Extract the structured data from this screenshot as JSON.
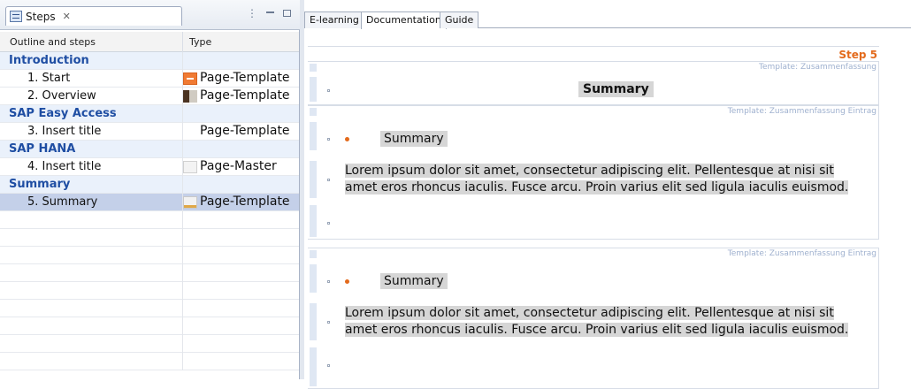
{
  "view": {
    "tab_label": "Steps",
    "close_glyph": "✕"
  },
  "table": {
    "headers": [
      "Outline and steps",
      "Type"
    ]
  },
  "tree": {
    "groups": [
      {
        "label": "Introduction",
        "steps": [
          {
            "label": "1. Start",
            "type": "Page-Template",
            "icon": "orange-template-icon"
          },
          {
            "label": "2. Overview",
            "type": "Page-Template",
            "icon": "photo-template-icon"
          }
        ]
      },
      {
        "label": "SAP Easy Access",
        "steps": [
          {
            "label": "3. Insert title",
            "type": "Page-Template",
            "icon": "none"
          }
        ]
      },
      {
        "label": "SAP HANA",
        "steps": [
          {
            "label": "4. Insert title",
            "type": "Page-Master",
            "icon": "blank-page-icon"
          }
        ]
      },
      {
        "label": "Summary",
        "steps": [
          {
            "label": "5. Summary",
            "type": "Page-Template",
            "icon": "sheet-template-icon",
            "selected": true
          }
        ]
      }
    ]
  },
  "editor": {
    "tabs": [
      {
        "label": "E-learning",
        "active": false
      },
      {
        "label": "Documentation",
        "active": true
      },
      {
        "label": "Guide",
        "active": false
      }
    ],
    "step_label": "Step 5",
    "blocks": [
      {
        "template_label": "Template: Zusammenfassung",
        "title": "Summary"
      },
      {
        "template_label": "Template: Zusammenfassung Eintrag",
        "heading": "Summary",
        "body": "Lorem ipsum dolor sit amet, consectetur adipiscing elit. Pellentesque at nisi sit amet eros rhoncus iaculis. Fusce arcu. Proin varius elit sed ligula iaculis euismod."
      },
      {
        "template_label": "Template: Zusammenfassung Eintrag",
        "heading": "Summary",
        "body": "Lorem ipsum dolor sit amet, consectetur adipiscing elit. Pellentesque at nisi sit amet eros rhoncus iaculis. Fusce arcu. Proin varius elit sed ligula iaculis euismod."
      }
    ]
  },
  "colors": {
    "group_text": "#1f4ea3",
    "selected_row": "#c4d0e9",
    "step_accent": "#e36a1c",
    "template_label": "#9fb1cf"
  }
}
